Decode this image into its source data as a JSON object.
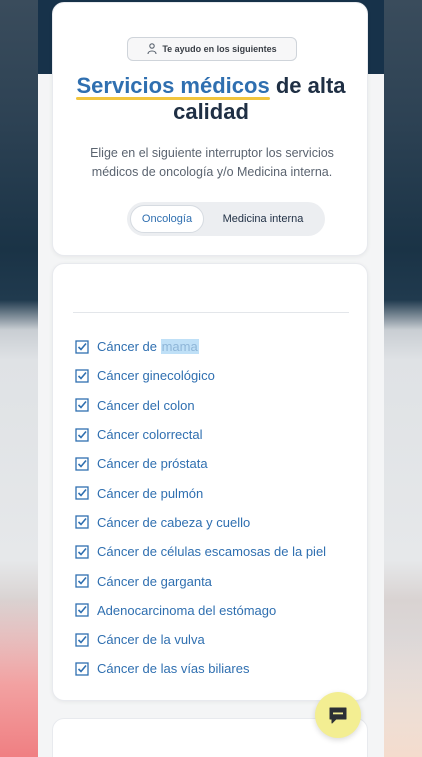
{
  "badge": {
    "label": "Te ayudo en los siguientes",
    "icon": "person-icon"
  },
  "headline": {
    "accent": "Servicios médicos",
    "rest": " de alta calidad"
  },
  "subtitle": "Elige en el siguiente interruptor los servicios médicos de oncología y/o Medicina interna.",
  "toggle": {
    "options": [
      "Oncología",
      "Medicina interna"
    ],
    "selected": "Oncología"
  },
  "services": {
    "items": [
      {
        "prefix": "Cáncer de ",
        "highlight": "mama"
      },
      {
        "prefix": "Cáncer ginecológico",
        "highlight": ""
      },
      {
        "prefix": "Cáncer del colon",
        "highlight": ""
      },
      {
        "prefix": "Cáncer colorrectal",
        "highlight": ""
      },
      {
        "prefix": "Cáncer de próstata",
        "highlight": ""
      },
      {
        "prefix": "Cáncer de pulmón",
        "highlight": ""
      },
      {
        "prefix": "Cáncer de cabeza y cuello",
        "highlight": ""
      },
      {
        "prefix": "Cáncer de células escamosas de la piel",
        "highlight": ""
      },
      {
        "prefix": "Cáncer de garganta",
        "highlight": ""
      },
      {
        "prefix": "Adenocarcinoma del estómago",
        "highlight": ""
      },
      {
        "prefix": "Cáncer de la vulva",
        "highlight": ""
      },
      {
        "prefix": "Cáncer de las vías biliares",
        "highlight": ""
      }
    ]
  },
  "chat": {
    "icon": "chat-icon"
  },
  "colors": {
    "accent": "#2f6fb0",
    "underline": "#f2c53d",
    "chat_button": "#f3ee92",
    "header_dark": "#17324a"
  }
}
